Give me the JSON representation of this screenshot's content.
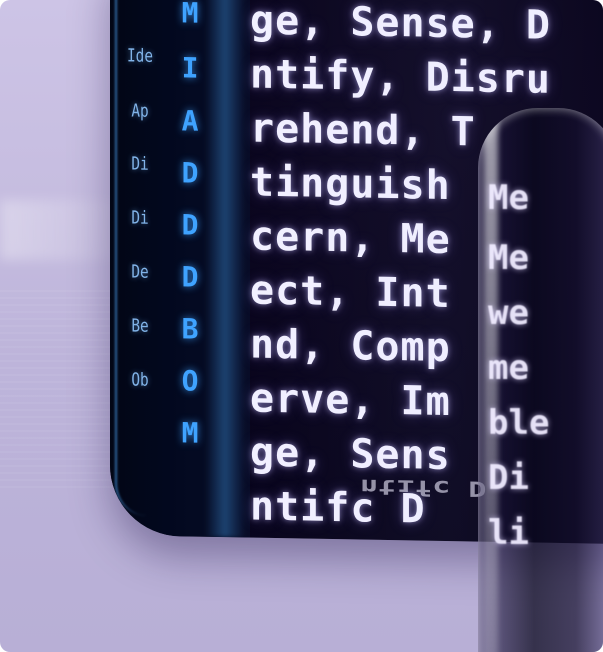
{
  "code_lines": [
    "ge, Sense, D",
    "ntify, Disru",
    "rehend, T",
    "tinguish",
    "cern, Me",
    "ect, Int",
    "nd, Comp",
    "erve, Im",
    "ge, Sens",
    "ntifc   D"
  ],
  "column_letters": [
    "M",
    "I",
    "A",
    "D",
    "D",
    "D",
    "B",
    "O",
    "M"
  ],
  "tiny_labels": [
    "Ide",
    "Ap",
    "Di",
    "Di",
    "De",
    "Be",
    "Ob"
  ],
  "rod_lines": [
    "Me",
    "Me",
    "we",
    "me",
    "ble",
    "Di",
    "li"
  ],
  "reflection_text": "ntifc   D"
}
